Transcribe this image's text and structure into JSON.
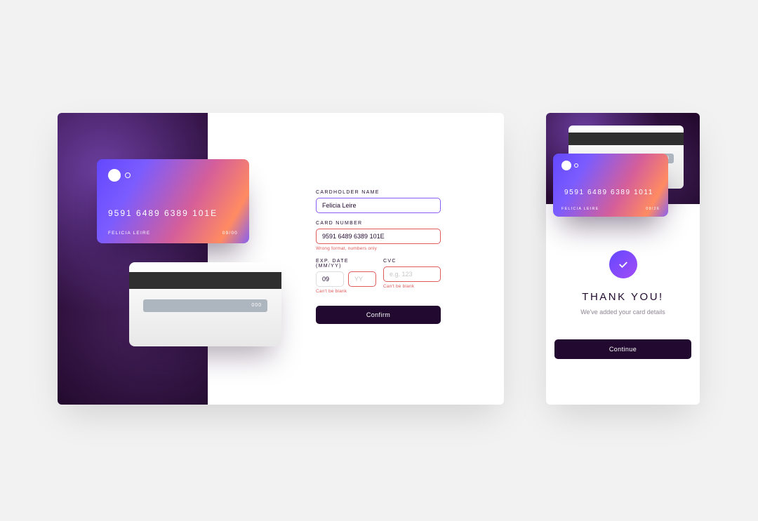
{
  "desktop": {
    "card_front": {
      "number": "9591 6489 6389 101E",
      "name": "FELICIA LEIRE",
      "expiry": "09/00"
    },
    "card_back": {
      "cvc": "000"
    },
    "form": {
      "cardholder": {
        "label": "CARDHOLDER NAME",
        "value": "Felicia Leire"
      },
      "cardnumber": {
        "label": "CARD NUMBER",
        "value": "9591 6489 6389 101E",
        "error": "Wrong format, numbers only"
      },
      "exp": {
        "label": "EXP. DATE (MM/YY)",
        "mm_value": "09",
        "yy_placeholder": "YY",
        "error": "Can't be blank"
      },
      "cvc": {
        "label": "CVC",
        "placeholder": "e.g. 123",
        "error": "Can't be blank"
      },
      "confirm_label": "Confirm"
    }
  },
  "mobile": {
    "card_front": {
      "number": "9591 6489 6389 1011",
      "name": "FELICIA LEIRE",
      "expiry": "09/26"
    },
    "card_back": {
      "cvc": "123"
    },
    "thankyou": {
      "title": "THANK YOU!",
      "subtitle": "We've added your card details",
      "continue_label": "Continue"
    }
  },
  "colors": {
    "bg": "#f2f2f2",
    "dark": "#21092f",
    "error": "#e05b5b",
    "focus": "#8a5cf6"
  }
}
